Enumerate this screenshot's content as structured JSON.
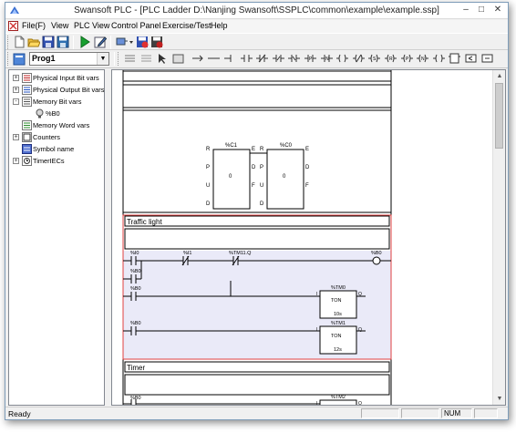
{
  "window": {
    "title": "Swansoft PLC - [PLC Ladder  D:\\Nanjing Swansoft\\SSPLC\\common\\example\\example.ssp]",
    "minimize": "–",
    "maximize": "□",
    "close": "✕"
  },
  "menu": [
    {
      "label": "File(F)"
    },
    {
      "label": "View"
    },
    {
      "label": "PLC View"
    },
    {
      "label": "Control Panel"
    },
    {
      "label": "Exercise/Test"
    },
    {
      "label": "Help"
    }
  ],
  "program_selector": {
    "value": "Prog1"
  },
  "tree": [
    {
      "label": "Physical Input Bit vars",
      "expander": "+"
    },
    {
      "label": "Physical Output Bit vars",
      "expander": "+"
    },
    {
      "label": "Memory Bit vars",
      "expander": "-"
    },
    {
      "label": "%B0",
      "expander": ""
    },
    {
      "label": "Memory Word vars",
      "expander": ""
    },
    {
      "label": "Counters",
      "expander": "+"
    },
    {
      "label": "Symbol name",
      "expander": ""
    },
    {
      "label": "TimerIECs",
      "expander": "+"
    }
  ],
  "ladder": {
    "counter_block_1": {
      "name": "%C1",
      "value": "0",
      "left_pins": [
        "R",
        "P",
        "U",
        "D"
      ],
      "right_pins": [
        "E",
        "D",
        "F"
      ]
    },
    "counter_block_2": {
      "name": "%C0",
      "value": "0",
      "left_pins": [
        "R",
        "P",
        "U",
        "D"
      ],
      "right_pins": [
        "E",
        "D",
        "F"
      ]
    },
    "rung_traffic": {
      "title": "Traffic light",
      "contacts": [
        "%I0",
        "%I1",
        "%TM11.Q",
        "%B0",
        "%B0",
        "%B0"
      ],
      "coil": "%B0",
      "timers": [
        {
          "name": "%TM0",
          "type": "TON",
          "preset": "10s",
          "in": "I",
          "out": "Q"
        },
        {
          "name": "%TM1",
          "type": "TON",
          "preset": "12s",
          "in": "I",
          "out": "Q"
        }
      ]
    },
    "rung_timer": {
      "title": "Timer",
      "contact": "%B0",
      "timer": {
        "name": "%TM2",
        "in": "I",
        "out": "Q"
      }
    }
  },
  "status": {
    "ready": "Ready",
    "num": "NUM"
  },
  "colors": {
    "rung_highlight": "#eaeaf8",
    "rung_border_selected": "#e04040",
    "coil_blue": "#2040a0"
  }
}
